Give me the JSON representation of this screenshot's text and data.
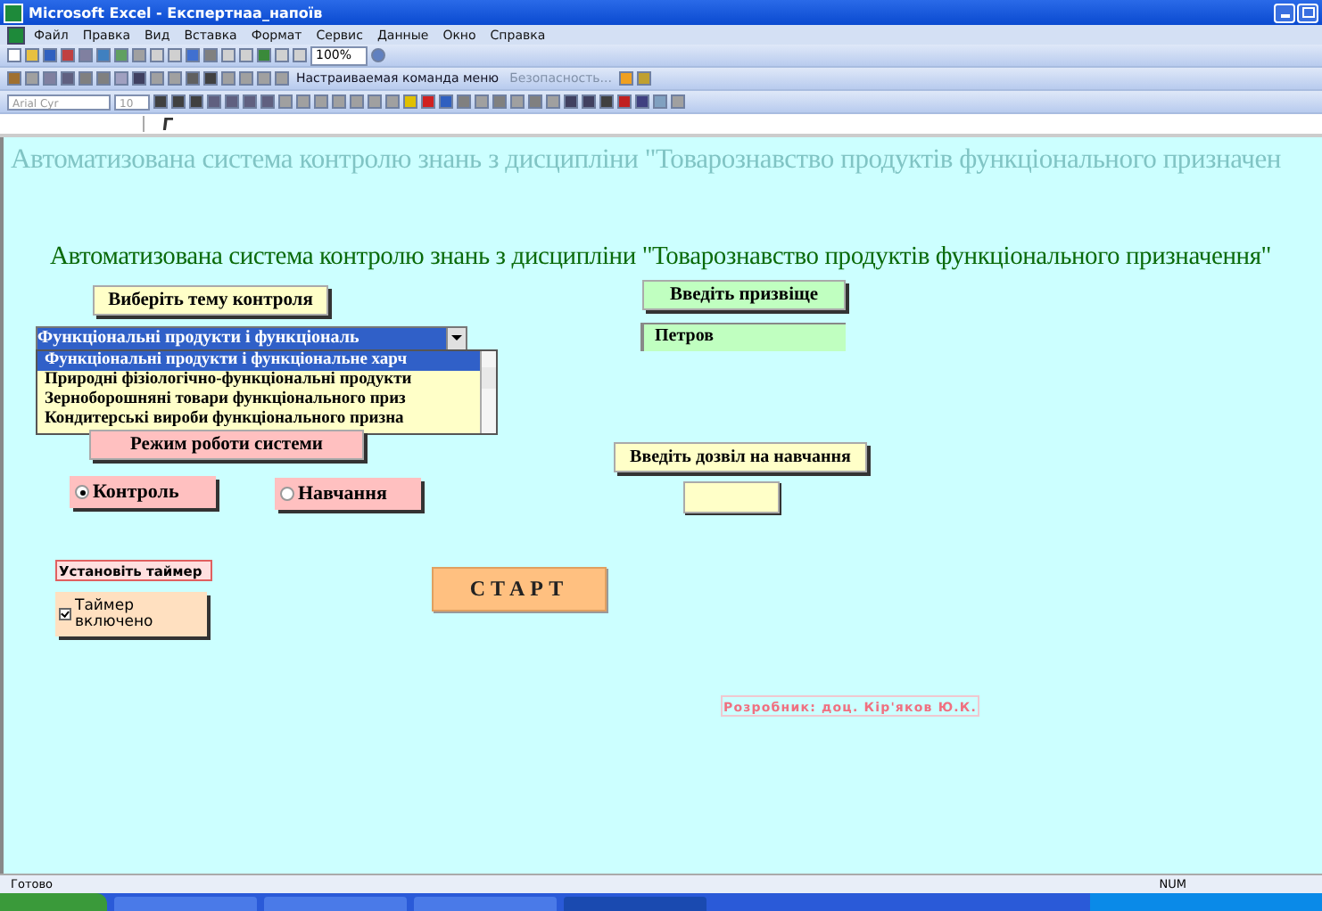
{
  "window": {
    "title": "Microsoft Excel - Експертнаа_напоїв"
  },
  "menu": [
    "Файл",
    "Правка",
    "Вид",
    "Вставка",
    "Формат",
    "Сервис",
    "Данные",
    "Окно",
    "Справка"
  ],
  "toolbar": {
    "zoom": "100%",
    "custom_command": "Настраиваемая команда меню",
    "security": "Безопасность...",
    "font": "Arial Cyr",
    "font_size": "10"
  },
  "sheet": {
    "banner": "Автоматизована система контролю знань з дисципліни \"Товарознавство продуктів функціонального призначен",
    "title": "Автоматизована система контролю знань з дисципліни \"Товарознавство продуктів функціонального призначення\"",
    "topic_label": "Виберіть  тему контроля",
    "topic_value": "Функціональні продукти і функціональ",
    "topic_list": [
      {
        "label": "Функціональні продукти і функціональне харч",
        "selected": true
      },
      {
        "label": "Природні фізіологічно-функціональні продукти",
        "selected": false
      },
      {
        "label": "Зернoборошняні товари функціонального приз",
        "selected": false
      },
      {
        "label": "Кондитерські вироби функціонального призна",
        "selected": false
      }
    ],
    "mode_label": "Режим роботи системи",
    "modes": [
      {
        "label": "Контроль",
        "selected": true
      },
      {
        "label": "Навчання",
        "selected": false
      }
    ],
    "timer_label": "Установіть таймер",
    "timer": {
      "label": "Таймер включено",
      "checked": true
    },
    "start": "СТАРТ",
    "surname_label": "Введіть призвіще",
    "surname": "Петров",
    "permit_label": "Введіть дозвіл на навчання",
    "author": "Розробник: доц. Кір'яков Ю.К."
  },
  "status_bar": {
    "text": "Готово",
    "num": "NUM"
  }
}
